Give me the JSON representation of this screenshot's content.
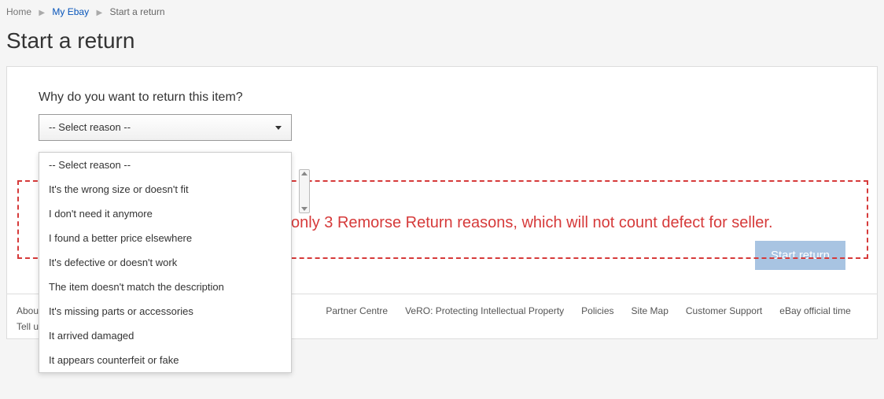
{
  "breadcrumb": {
    "home": "Home",
    "myebay": "My Ebay",
    "current": "Start a return"
  },
  "title": "Start a return",
  "prompt": "Why do you want to return this item?",
  "select": {
    "placeholder": "-- Select reason --",
    "options": [
      "-- Select reason --",
      "It's the wrong size or doesn't fit",
      "I don't need it anymore",
      "I found a better price elsewhere",
      "It's defective or doesn't work",
      "The item doesn't match the description",
      "It's missing parts or accessories",
      "It arrived damaged",
      "It appears counterfeit or fake"
    ]
  },
  "annotation": "The only 3 Remorse Return reasons, which will not count defect for seller.",
  "button": {
    "start": "Start return"
  },
  "footer": {
    "links": {
      "about_trunc": "About",
      "partner": "Partner Centre",
      "vero": "VeRO: Protecting Intellectual Property",
      "policies": "Policies",
      "sitemap": "Site Map",
      "support": "Customer Support",
      "time": "eBay official time"
    },
    "tell_trunc": "Tell u"
  }
}
